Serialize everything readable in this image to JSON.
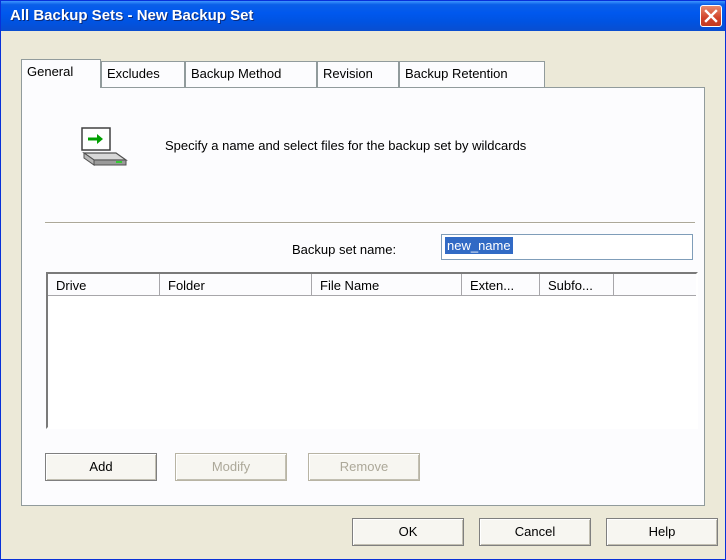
{
  "window": {
    "title": "All Backup Sets - New Backup Set"
  },
  "tabs": [
    {
      "label": "General"
    },
    {
      "label": "Excludes"
    },
    {
      "label": "Backup Method"
    },
    {
      "label": "Revision"
    },
    {
      "label": "Backup Retention"
    }
  ],
  "general": {
    "description": "Specify a name and select files for the backup set by wildcards",
    "name_label": "Backup set name:",
    "name_value": "new_name",
    "columns": [
      "Drive",
      "Folder",
      "File Name",
      "Exten...",
      "Subfo..."
    ],
    "buttons": {
      "add": "Add",
      "modify": "Modify",
      "remove": "Remove"
    }
  },
  "footer": {
    "ok": "OK",
    "cancel": "Cancel",
    "help": "Help"
  },
  "icons": {
    "close": "close-icon",
    "header": "backup-drive-icon"
  }
}
